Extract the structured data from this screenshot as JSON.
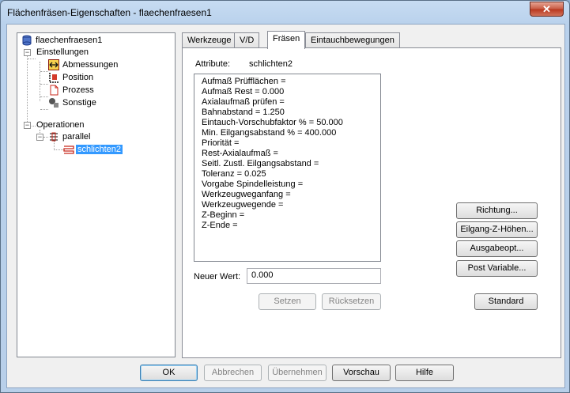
{
  "window": {
    "title": "Flächenfräsen-Eigenschaften - flaechenfraesen1",
    "close_glyph": "✕"
  },
  "tree": {
    "root": "flaechenfraesen1",
    "settings": "Einstellungen",
    "settings_items": [
      "Abmessungen",
      "Position",
      "Prozess",
      "Sonstige"
    ],
    "operations": "Operationen",
    "group": "parallel",
    "selected": "schlichten2",
    "expander_minus": "−"
  },
  "tabs": [
    "Werkzeuge",
    "V/D",
    "Fräsen",
    "Eintauchbewegungen"
  ],
  "panel": {
    "attr_label": "Attribute:",
    "attr_value": "schlichten2",
    "attributes": [
      "Aufmaß Prüfflächen =",
      "Aufmaß Rest = 0.000",
      "Axialaufmaß prüfen =",
      "Bahnabstand = 1.250",
      "Eintauch-Vorschubfaktor % = 50.000",
      "Min. Eilgangsabstand % = 400.000",
      "Priorität =",
      "Rest-Axialaufmaß =",
      "Seitl. Zustl. Eilgangsabstand =",
      "Toleranz = 0.025",
      "Vorgabe Spindelleistung =",
      "Werkzeugweganfang =",
      "Werkzeugwegende =",
      "Z-Beginn =",
      "Z-Ende ="
    ],
    "new_value_label": "Neuer Wert:",
    "new_value": "0.000",
    "set_button": "Setzen",
    "reset_button": "Rücksetzen",
    "side_buttons": [
      "Richtung...",
      "Eilgang-Z-Höhen...",
      "Ausgabeopt...",
      "Post Variable..."
    ],
    "standard_button": "Standard"
  },
  "footer": {
    "ok": "OK",
    "cancel": "Abbrechen",
    "apply": "Übernehmen",
    "preview": "Vorschau",
    "help": "Hilfe"
  }
}
